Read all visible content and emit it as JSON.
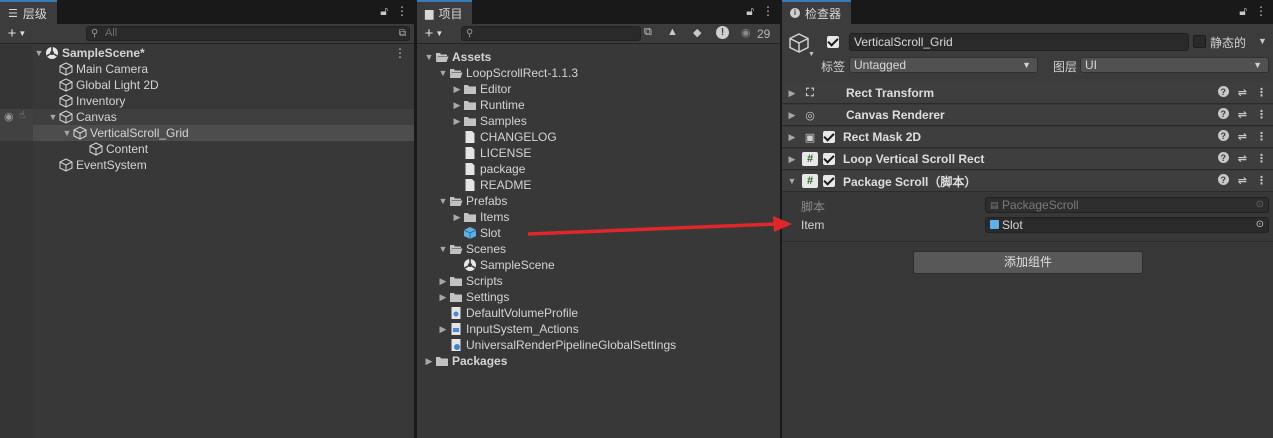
{
  "hierarchy": {
    "tab_label": "层级",
    "search_placeholder": "All",
    "rows": [
      {
        "label": "SampleScene*"
      },
      {
        "label": "Main Camera"
      },
      {
        "label": "Global Light 2D"
      },
      {
        "label": "Inventory"
      },
      {
        "label": "Canvas"
      },
      {
        "label": "VerticalScroll_Grid"
      },
      {
        "label": "Content"
      },
      {
        "label": "EventSystem"
      }
    ]
  },
  "project": {
    "tab_label": "项目",
    "hidden_count": "29",
    "rows": [
      {
        "label": "Assets"
      },
      {
        "label": "LoopScrollRect-1.1.3"
      },
      {
        "label": "Editor"
      },
      {
        "label": "Runtime"
      },
      {
        "label": "Samples"
      },
      {
        "label": "CHANGELOG"
      },
      {
        "label": "LICENSE"
      },
      {
        "label": "package"
      },
      {
        "label": "README"
      },
      {
        "label": "Prefabs"
      },
      {
        "label": "Items"
      },
      {
        "label": "Slot"
      },
      {
        "label": "Scenes"
      },
      {
        "label": "SampleScene"
      },
      {
        "label": "Scripts"
      },
      {
        "label": "Settings"
      },
      {
        "label": "DefaultVolumeProfile"
      },
      {
        "label": "InputSystem_Actions"
      },
      {
        "label": "UniversalRenderPipelineGlobalSettings"
      },
      {
        "label": "Packages"
      }
    ]
  },
  "inspector": {
    "tab_label": "检查器",
    "object_name": "VerticalScroll_Grid",
    "static_label": "静态的",
    "tag_label": "标签",
    "tag_value": "Untagged",
    "layer_label": "图层",
    "layer_value": "UI",
    "components": [
      {
        "label": "Rect Transform"
      },
      {
        "label": "Canvas Renderer"
      },
      {
        "label": "Rect Mask 2D"
      },
      {
        "label": "Loop Vertical Scroll Rect"
      },
      {
        "label": "Package Scroll（脚本）"
      }
    ],
    "script_label": "脚本",
    "script_value": "PackageScroll",
    "item_label": "Item",
    "item_value": "Slot",
    "add_component": "添加组件"
  },
  "colors": {
    "selection": "#4d4d4d",
    "accent_tab": "#3a79bb",
    "arrow": "#e0262a",
    "prefab_blue": "#5fb2e8"
  }
}
